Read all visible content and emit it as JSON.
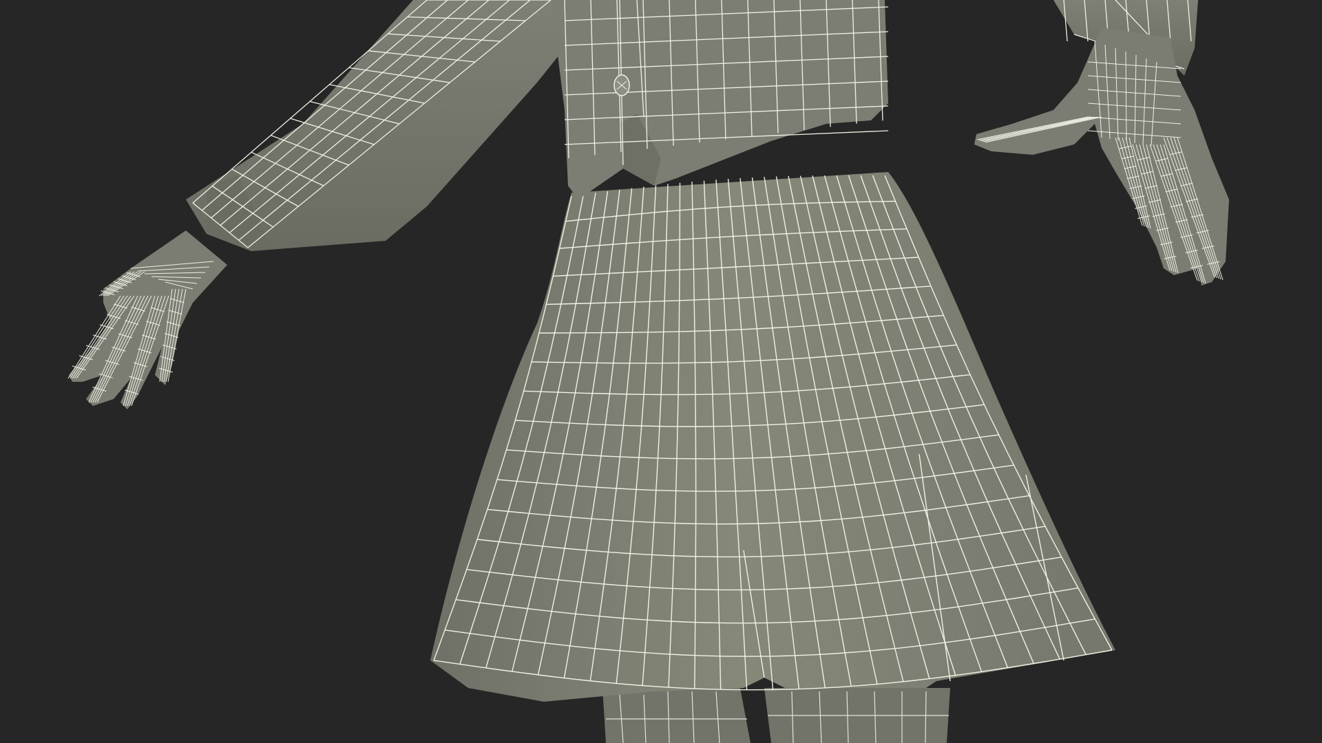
{
  "scene": {
    "background_color": "#262626",
    "mesh_fill": "#7b7d72",
    "mesh_fill_shade": "#6b6d63",
    "mesh_fill_light": "#8a8c80",
    "wire_color": "#f2f1e6",
    "render_style": "wireframe-on-shaded",
    "subject": "female-school-uniform-3d-model"
  }
}
